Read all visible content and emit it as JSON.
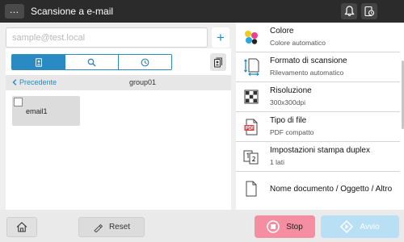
{
  "header": {
    "title": "Scansione a e-mail",
    "menu_label": "…"
  },
  "address": {
    "placeholder": "sample@test.local",
    "add_label": "+"
  },
  "breadcrumb": {
    "back_label": "Precedente",
    "group_name": "group01"
  },
  "entries": [
    {
      "name": "email1"
    }
  ],
  "settings": [
    {
      "title": "Colore",
      "value": "Colore automatico"
    },
    {
      "title": "Formato di scansione",
      "value": "Rilevamento automatico"
    },
    {
      "title": "Risoluzione",
      "value": "300x300dpi"
    },
    {
      "title": "Tipo di file",
      "value": "PDF compatto"
    },
    {
      "title": "Impostazioni stampa duplex",
      "value": "1 lati"
    },
    {
      "title": "Nome documento / Oggetto / Altro",
      "value": ""
    }
  ],
  "footer": {
    "reset_label": "Reset",
    "stop_label": "Stop",
    "start_label": "Avvio"
  },
  "colors": {
    "accent": "#2a8ac3",
    "stop": "#f48ea0",
    "start": "#b8dff3"
  }
}
